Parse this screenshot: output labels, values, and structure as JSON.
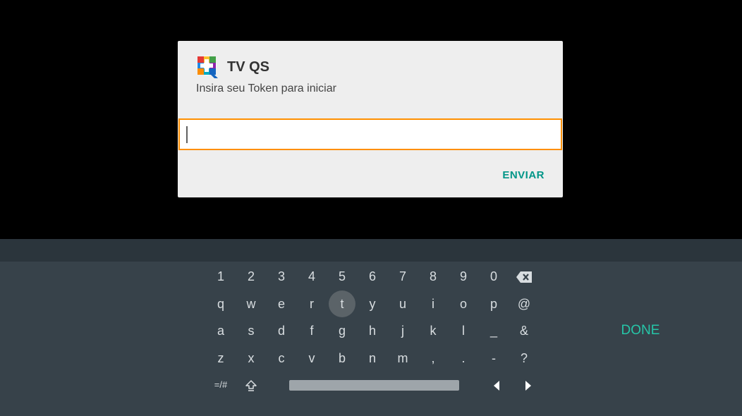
{
  "dialog": {
    "app_title": "TV QS",
    "subtitle": "Insira seu Token para iniciar",
    "token_value": "",
    "submit_label": "ENVIAR",
    "logo_icon": "tv-qs-logo-icon",
    "colors": {
      "input_border": "#ff8f00",
      "submit": "#009688"
    }
  },
  "keyboard": {
    "rows": [
      [
        "1",
        "2",
        "3",
        "4",
        "5",
        "6",
        "7",
        "8",
        "9",
        "0"
      ],
      [
        "q",
        "w",
        "e",
        "r",
        "t",
        "y",
        "u",
        "i",
        "o",
        "p",
        "@"
      ],
      [
        "a",
        "s",
        "d",
        "f",
        "g",
        "h",
        "j",
        "k",
        "l",
        "_",
        "&"
      ],
      [
        "z",
        "x",
        "c",
        "v",
        "b",
        "n",
        "m",
        ",",
        ".",
        "-",
        "?"
      ]
    ],
    "backspace_icon": "backspace-icon",
    "symbols_label": "=/#",
    "shift_icon": "shift-icon",
    "cursor_left_icon": "arrow-left-icon",
    "cursor_right_icon": "arrow-right-icon",
    "focused_key": "t",
    "done_label": "DONE",
    "colors": {
      "done": "#26c6a8",
      "background": "#37424a"
    }
  }
}
